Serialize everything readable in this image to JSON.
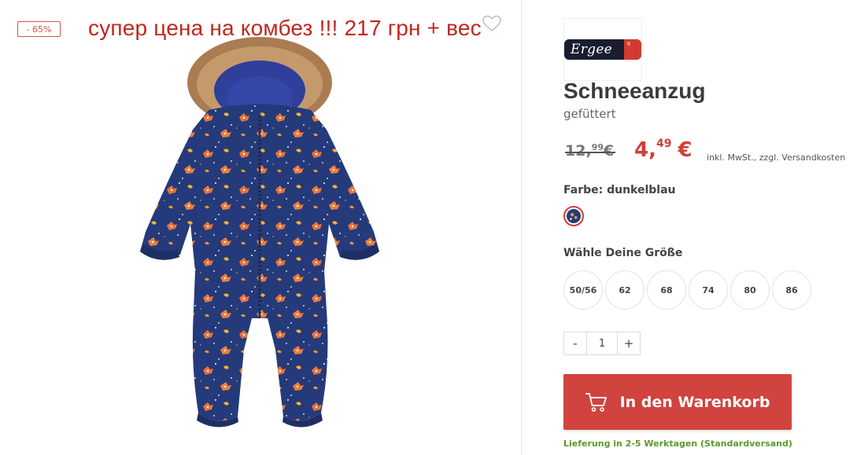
{
  "image": {
    "discount_badge": "- 65%",
    "overlay_caption": "супер цена на комбез !!! 217 грн + вес"
  },
  "brand": {
    "name": "Ergee"
  },
  "product": {
    "title": "Schneeanzug",
    "subtitle": "gefüttert"
  },
  "price": {
    "old_main": "12,",
    "old_cents": "99",
    "old_currency": "€",
    "new_main": "4,",
    "new_cents": "49",
    "new_currency": "€",
    "vat_note": "inkl. MwSt., zzgl. Versandkosten"
  },
  "color": {
    "label": "Farbe: dunkelblau",
    "selected": "dunkelblau"
  },
  "size": {
    "label": "Wähle Deine Größe",
    "options": [
      "50/56",
      "62",
      "68",
      "74",
      "80",
      "86"
    ]
  },
  "quantity": {
    "minus": "-",
    "value": "1",
    "plus": "+"
  },
  "cart": {
    "label": "In den Warenkorb"
  },
  "delivery": {
    "text": "Lieferung in 2-5 Werktagen (Standardversand)"
  },
  "colors": {
    "accent": "#d0433f",
    "sale": "#cf3f39",
    "delivery": "#5a9a2c",
    "caption": "#c0281e"
  },
  "icons": [
    "heart-outline-icon",
    "shopping-cart-icon"
  ]
}
